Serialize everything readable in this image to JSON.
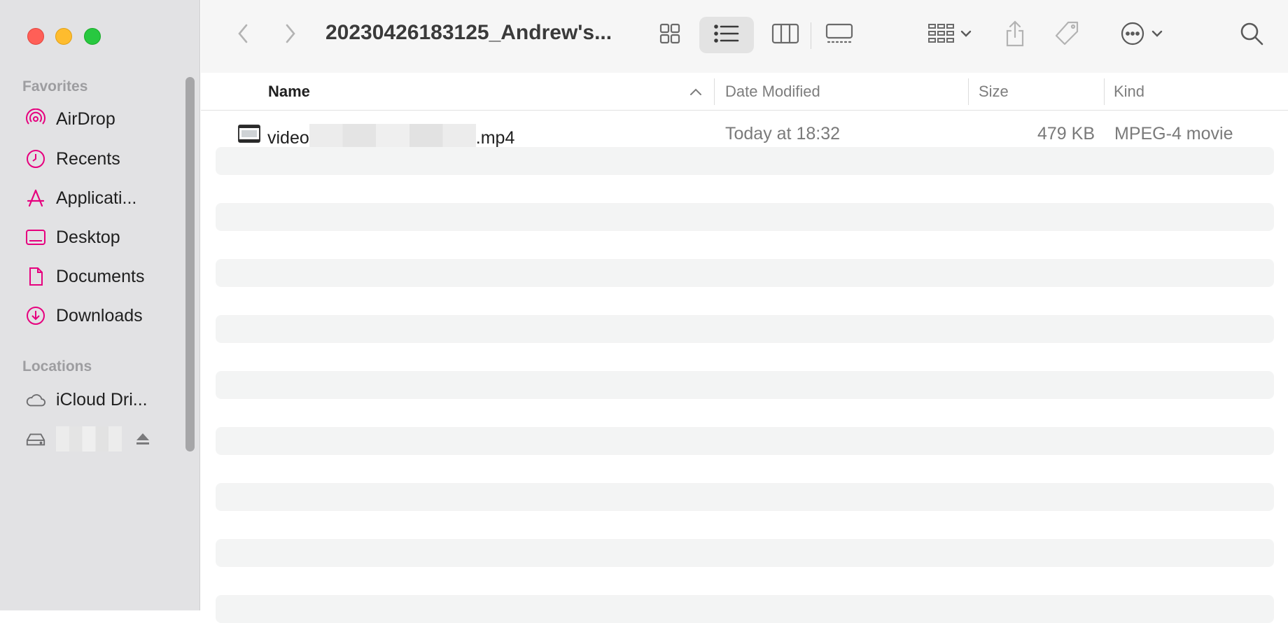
{
  "window": {
    "title": "20230426183125_Andrew's..."
  },
  "sidebar": {
    "favorites_heading": "Favorites",
    "locations_heading": "Locations",
    "favorites": [
      {
        "label": "AirDrop",
        "icon": "airdrop-icon"
      },
      {
        "label": "Recents",
        "icon": "clock-icon"
      },
      {
        "label": "Applicati...",
        "icon": "applications-icon"
      },
      {
        "label": "Desktop",
        "icon": "desktop-icon"
      },
      {
        "label": "Documents",
        "icon": "document-icon"
      },
      {
        "label": "Downloads",
        "icon": "download-icon"
      }
    ],
    "locations": [
      {
        "label": "iCloud Dri...",
        "icon": "cloud-icon"
      },
      {
        "label": "",
        "icon": "drive-icon",
        "eject": "eject-icon"
      }
    ],
    "accent_color": "#e6007e"
  },
  "columns": {
    "name": "Name",
    "date": "Date Modified",
    "size": "Size",
    "kind": "Kind"
  },
  "files": [
    {
      "name_prefix": "video",
      "name_suffix": ".mp4",
      "date": "Today at 18:32",
      "size": "479 KB",
      "kind": "MPEG-4 movie"
    }
  ]
}
